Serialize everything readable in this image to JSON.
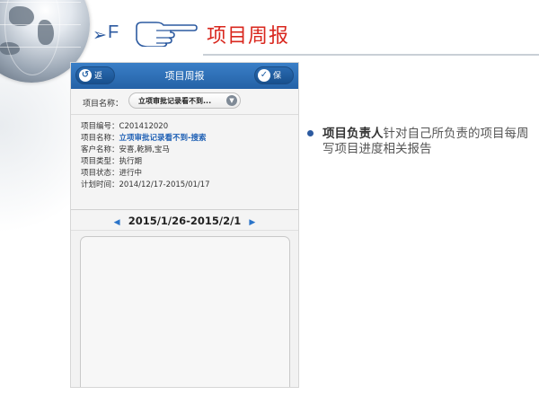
{
  "slide": {
    "arrow_marker": "➢",
    "section_letter": "F",
    "title": "项目周报",
    "accent_color": "#d9271e",
    "bullet_emphasis": "项目负责人",
    "bullet_rest": "针对自己所负责的项目每周写项目进度相关报告"
  },
  "app": {
    "header": {
      "back_label": "返回",
      "title": "项目周报",
      "save_label": "保存",
      "nav_color": "#2a6db5"
    },
    "project_selector": {
      "label": "项目名称：",
      "value": "立项审批记录看不到..."
    },
    "project_info": {
      "code_label": "项目编号：",
      "code": "C201412020",
      "name_label": "项目名称：",
      "name": "立项审批记录看不到-搜索",
      "customer_label": "客户名称：",
      "customer": "安喜,乾狮,宝马",
      "type_label": "项目类型：",
      "type": "执行期",
      "status_label": "项目状态：",
      "status": "进行中",
      "plan_label": "计划时间：",
      "plan": "2014/12/17-2015/01/17"
    },
    "week": {
      "prev_icon": "◀",
      "range": "2015/1/26-2015/2/1",
      "next_icon": "▶"
    },
    "report_text": ""
  }
}
